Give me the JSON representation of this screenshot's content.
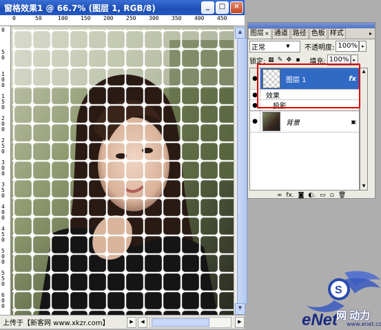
{
  "document": {
    "title": "窗格效果1 @ 66.7% (图层 1, RGB/8)",
    "buttons": {
      "minimize": "_",
      "maximize": "□",
      "close": "×"
    },
    "ruler_h_numbers": [
      "0",
      "50",
      "100",
      "150",
      "200",
      "250",
      "300",
      "350",
      "400",
      "450"
    ],
    "ruler_v_numbers": [
      "0",
      "50",
      "100",
      "150",
      "200",
      "250",
      "300",
      "350",
      "400",
      "450",
      "500",
      "550",
      "600"
    ],
    "status_text": "上传于【新客网 www.xkzr.com】"
  },
  "layers_panel": {
    "tabs": [
      {
        "label": "图层",
        "close": "×"
      },
      {
        "label": "通道"
      },
      {
        "label": "路径"
      },
      {
        "label": "色板"
      },
      {
        "label": "样式"
      }
    ],
    "tab_menu": "▸",
    "blend_mode": "正常",
    "opacity_label": "不透明度:",
    "opacity_value": "100%",
    "lock_label": "锁定:",
    "fill_label": "填充:",
    "fill_value": "100%",
    "layers": [
      {
        "name": "图层 1",
        "fx": "fx",
        "selected": true
      },
      {
        "name": "背景",
        "lock": "🔒",
        "selected": false
      }
    ],
    "effects_label": "效果",
    "drop_shadow_label": "投影",
    "footer_icons": [
      "link-icon",
      "fx-icon",
      "mask-icon",
      "adjustment-icon",
      "folder-icon",
      "new-layer-icon",
      "trash-icon"
    ],
    "footer_glyphs": [
      "∞",
      "fx.",
      "◙",
      "◐.",
      "▭",
      "▫",
      "🗑"
    ]
  },
  "watermark": {
    "brand": "eNet",
    "sub": "网 动力",
    "url": "www.enet.com.cn",
    "badge": "S"
  },
  "colors": {
    "selected_layer": "#316ac5",
    "highlight_box": "#e00000",
    "title_bar": "#1e4fb4"
  }
}
